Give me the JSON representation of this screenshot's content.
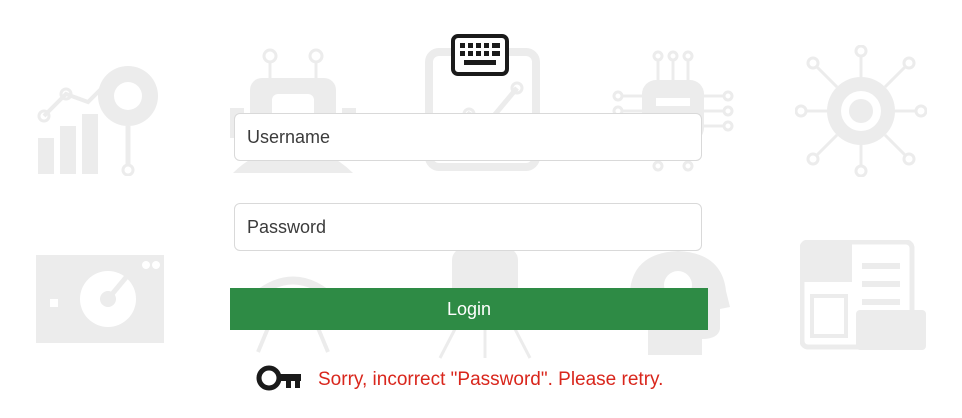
{
  "icons": {
    "keyboard": "keyboard-icon",
    "error": "key-icon"
  },
  "login_form": {
    "username_placeholder": "Username",
    "password_placeholder": "Password",
    "login_label": "Login"
  },
  "error": {
    "message": "Sorry, incorrect \"Password\". Please retry."
  },
  "colors": {
    "login_button": "#2e8b45",
    "error_text": "#d9261c",
    "background_icons": "#ececec"
  }
}
